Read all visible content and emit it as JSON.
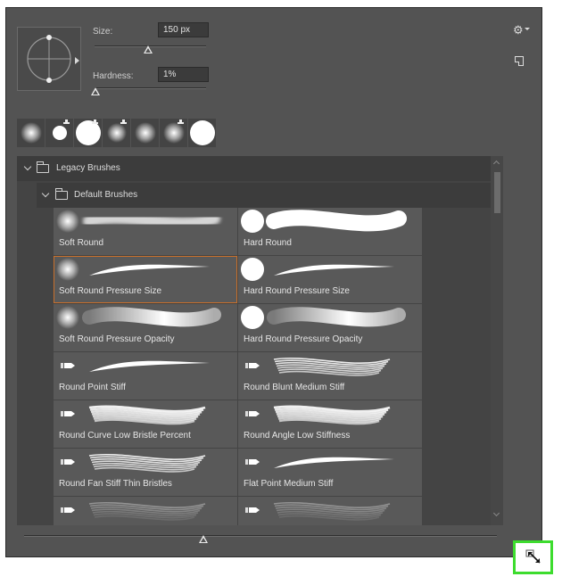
{
  "brush_settings": {
    "size_label": "Size:",
    "size_value": "150 px",
    "size_slider_fraction": 0.48,
    "hardness_label": "Hardness:",
    "hardness_value": "1%",
    "hardness_slider_fraction": 0.01
  },
  "icons": {
    "gear": "gear-icon",
    "new_preset": "new-preset-icon",
    "resize": "resize-icon"
  },
  "recent_brushes": [
    {
      "kind": "soft",
      "size": 12
    },
    {
      "kind": "hard",
      "size": 8,
      "badge": true
    },
    {
      "kind": "hard",
      "size": 14,
      "badge": true
    },
    {
      "kind": "soft",
      "size": 11,
      "badge": true
    },
    {
      "kind": "soft",
      "size": 12
    },
    {
      "kind": "soft",
      "size": 12,
      "badge": true
    },
    {
      "kind": "hard",
      "size": 14
    }
  ],
  "list": {
    "group_label": "Legacy Brushes",
    "subgroup_label": "Default Brushes",
    "brushes": [
      {
        "name": "Soft Round",
        "tip": "soft-circle",
        "stroke": "soft-even"
      },
      {
        "name": "Hard Round",
        "tip": "hard-circle",
        "stroke": "hard-even"
      },
      {
        "name": "Soft Round Pressure Size",
        "tip": "soft-circle",
        "stroke": "taper",
        "selected": true
      },
      {
        "name": "Hard Round Pressure Size",
        "tip": "hard-circle",
        "stroke": "taper"
      },
      {
        "name": "Soft Round Pressure Opacity",
        "tip": "soft-circle",
        "stroke": "soft-fade"
      },
      {
        "name": "Hard Round Pressure Opacity",
        "tip": "hard-circle",
        "stroke": "soft-fade"
      },
      {
        "name": "Round Point Stiff",
        "tip": "bristle",
        "stroke": "taper"
      },
      {
        "name": "Round Blunt Medium Stiff",
        "tip": "bristle",
        "stroke": "bristle"
      },
      {
        "name": "Round Curve Low Bristle Percent",
        "tip": "bristle",
        "stroke": "bristle-rough"
      },
      {
        "name": "Round Angle Low Stiffness",
        "tip": "bristle",
        "stroke": "bristle-rough"
      },
      {
        "name": "Round Fan Stiff Thin Bristles",
        "tip": "fan",
        "stroke": "bristle"
      },
      {
        "name": "Flat Point Medium Stiff",
        "tip": "bristle",
        "stroke": "taper"
      },
      {
        "name": "",
        "tip": "bristle",
        "stroke": "bristle-faint"
      },
      {
        "name": "",
        "tip": "bristle",
        "stroke": "bristle-faint"
      }
    ]
  },
  "bottom_slider_fraction": 0.38,
  "colors": {
    "panel": "#535353",
    "selection": "#c8702c",
    "highlight": "#3ddc2e"
  }
}
